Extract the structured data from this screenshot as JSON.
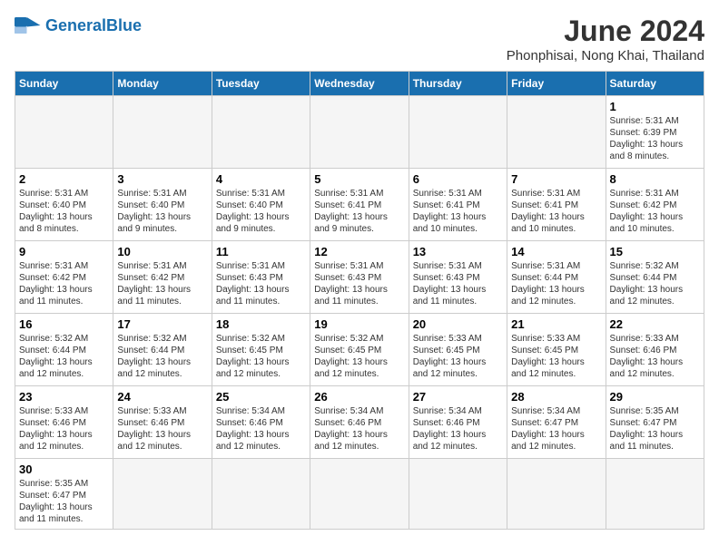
{
  "header": {
    "logo_general": "General",
    "logo_blue": "Blue",
    "title": "June 2024",
    "subtitle": "Phonphisai, Nong Khai, Thailand"
  },
  "weekdays": [
    "Sunday",
    "Monday",
    "Tuesday",
    "Wednesday",
    "Thursday",
    "Friday",
    "Saturday"
  ],
  "weeks": [
    [
      {
        "day": "",
        "info": ""
      },
      {
        "day": "",
        "info": ""
      },
      {
        "day": "",
        "info": ""
      },
      {
        "day": "",
        "info": ""
      },
      {
        "day": "",
        "info": ""
      },
      {
        "day": "",
        "info": ""
      },
      {
        "day": "1",
        "info": "Sunrise: 5:31 AM\nSunset: 6:39 PM\nDaylight: 13 hours and 8 minutes."
      }
    ],
    [
      {
        "day": "2",
        "info": "Sunrise: 5:31 AM\nSunset: 6:40 PM\nDaylight: 13 hours and 8 minutes."
      },
      {
        "day": "3",
        "info": "Sunrise: 5:31 AM\nSunset: 6:40 PM\nDaylight: 13 hours and 9 minutes."
      },
      {
        "day": "4",
        "info": "Sunrise: 5:31 AM\nSunset: 6:40 PM\nDaylight: 13 hours and 9 minutes."
      },
      {
        "day": "5",
        "info": "Sunrise: 5:31 AM\nSunset: 6:41 PM\nDaylight: 13 hours and 9 minutes."
      },
      {
        "day": "6",
        "info": "Sunrise: 5:31 AM\nSunset: 6:41 PM\nDaylight: 13 hours and 10 minutes."
      },
      {
        "day": "7",
        "info": "Sunrise: 5:31 AM\nSunset: 6:41 PM\nDaylight: 13 hours and 10 minutes."
      },
      {
        "day": "8",
        "info": "Sunrise: 5:31 AM\nSunset: 6:42 PM\nDaylight: 13 hours and 10 minutes."
      }
    ],
    [
      {
        "day": "9",
        "info": "Sunrise: 5:31 AM\nSunset: 6:42 PM\nDaylight: 13 hours and 11 minutes."
      },
      {
        "day": "10",
        "info": "Sunrise: 5:31 AM\nSunset: 6:42 PM\nDaylight: 13 hours and 11 minutes."
      },
      {
        "day": "11",
        "info": "Sunrise: 5:31 AM\nSunset: 6:43 PM\nDaylight: 13 hours and 11 minutes."
      },
      {
        "day": "12",
        "info": "Sunrise: 5:31 AM\nSunset: 6:43 PM\nDaylight: 13 hours and 11 minutes."
      },
      {
        "day": "13",
        "info": "Sunrise: 5:31 AM\nSunset: 6:43 PM\nDaylight: 13 hours and 11 minutes."
      },
      {
        "day": "14",
        "info": "Sunrise: 5:31 AM\nSunset: 6:44 PM\nDaylight: 13 hours and 12 minutes."
      },
      {
        "day": "15",
        "info": "Sunrise: 5:32 AM\nSunset: 6:44 PM\nDaylight: 13 hours and 12 minutes."
      }
    ],
    [
      {
        "day": "16",
        "info": "Sunrise: 5:32 AM\nSunset: 6:44 PM\nDaylight: 13 hours and 12 minutes."
      },
      {
        "day": "17",
        "info": "Sunrise: 5:32 AM\nSunset: 6:44 PM\nDaylight: 13 hours and 12 minutes."
      },
      {
        "day": "18",
        "info": "Sunrise: 5:32 AM\nSunset: 6:45 PM\nDaylight: 13 hours and 12 minutes."
      },
      {
        "day": "19",
        "info": "Sunrise: 5:32 AM\nSunset: 6:45 PM\nDaylight: 13 hours and 12 minutes."
      },
      {
        "day": "20",
        "info": "Sunrise: 5:33 AM\nSunset: 6:45 PM\nDaylight: 13 hours and 12 minutes."
      },
      {
        "day": "21",
        "info": "Sunrise: 5:33 AM\nSunset: 6:45 PM\nDaylight: 13 hours and 12 minutes."
      },
      {
        "day": "22",
        "info": "Sunrise: 5:33 AM\nSunset: 6:46 PM\nDaylight: 13 hours and 12 minutes."
      }
    ],
    [
      {
        "day": "23",
        "info": "Sunrise: 5:33 AM\nSunset: 6:46 PM\nDaylight: 13 hours and 12 minutes."
      },
      {
        "day": "24",
        "info": "Sunrise: 5:33 AM\nSunset: 6:46 PM\nDaylight: 13 hours and 12 minutes."
      },
      {
        "day": "25",
        "info": "Sunrise: 5:34 AM\nSunset: 6:46 PM\nDaylight: 13 hours and 12 minutes."
      },
      {
        "day": "26",
        "info": "Sunrise: 5:34 AM\nSunset: 6:46 PM\nDaylight: 13 hours and 12 minutes."
      },
      {
        "day": "27",
        "info": "Sunrise: 5:34 AM\nSunset: 6:46 PM\nDaylight: 13 hours and 12 minutes."
      },
      {
        "day": "28",
        "info": "Sunrise: 5:34 AM\nSunset: 6:47 PM\nDaylight: 13 hours and 12 minutes."
      },
      {
        "day": "29",
        "info": "Sunrise: 5:35 AM\nSunset: 6:47 PM\nDaylight: 13 hours and 11 minutes."
      }
    ],
    [
      {
        "day": "30",
        "info": "Sunrise: 5:35 AM\nSunset: 6:47 PM\nDaylight: 13 hours and 11 minutes."
      },
      {
        "day": "",
        "info": ""
      },
      {
        "day": "",
        "info": ""
      },
      {
        "day": "",
        "info": ""
      },
      {
        "day": "",
        "info": ""
      },
      {
        "day": "",
        "info": ""
      },
      {
        "day": "",
        "info": ""
      }
    ]
  ]
}
